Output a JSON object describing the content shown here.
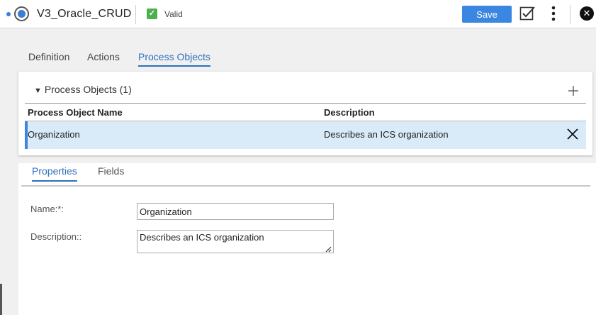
{
  "header": {
    "title": "V3_Oracle_CRUD",
    "status": "Valid",
    "save_label": "Save"
  },
  "tabs": [
    {
      "label": "Definition",
      "active": false
    },
    {
      "label": "Actions",
      "active": false
    },
    {
      "label": "Process Objects",
      "active": true
    }
  ],
  "process_objects": {
    "section_label": "Process Objects (1)",
    "columns": [
      "Process Object Name",
      "Description"
    ],
    "rows": [
      {
        "name": "Organization",
        "description": "Describes an ICS organization"
      }
    ]
  },
  "details": {
    "tabs": [
      {
        "label": "Properties",
        "active": true
      },
      {
        "label": "Fields",
        "active": false
      }
    ],
    "name_label": "Name:*:",
    "name_value": "Organization",
    "description_label": "Description::",
    "description_value": "Describes an ICS organization"
  },
  "colors": {
    "accent": "#3a86e0",
    "selected_row": "#d9eaf8",
    "valid": "#4caf50"
  },
  "icons": [
    "app-icon",
    "valid-check-icon",
    "checklist-icon",
    "more-vertical-icon",
    "close-icon",
    "add-icon",
    "remove-icon"
  ]
}
